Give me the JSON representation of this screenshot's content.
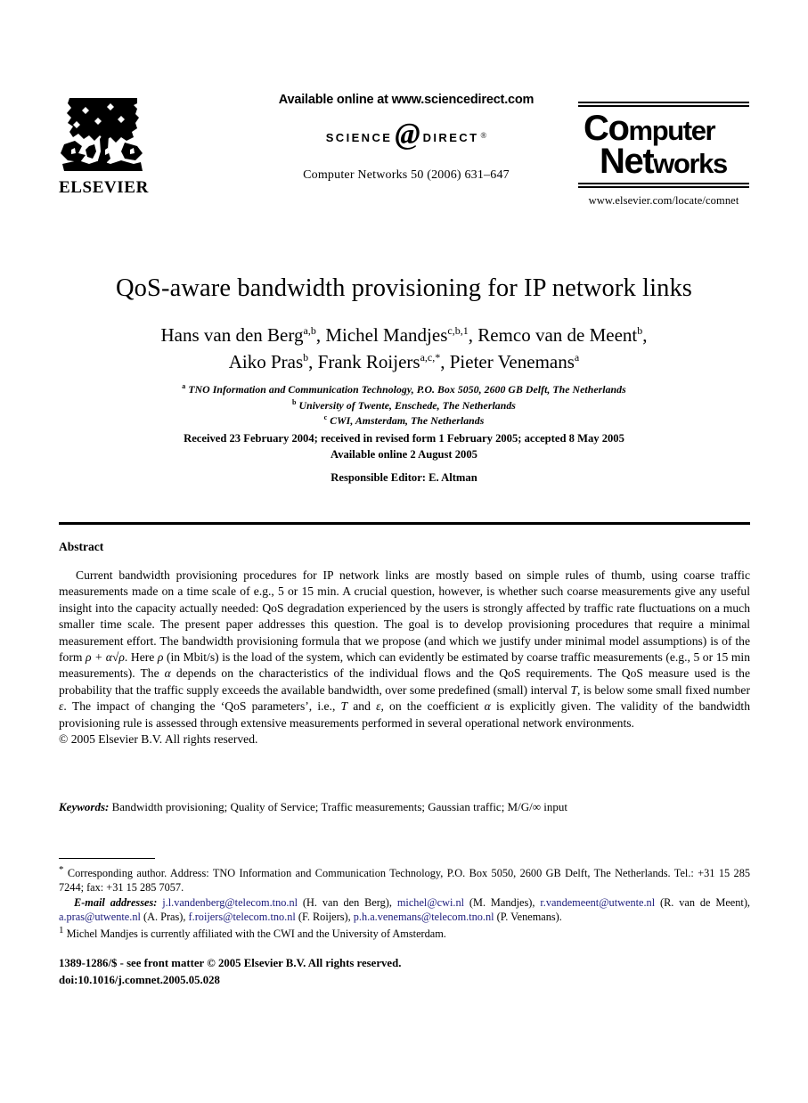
{
  "masthead": {
    "elsevier_wordmark": "ELSEVIER",
    "available_online": "Available online at www.sciencedirect.com",
    "sciencedirect_science": "SCIENCE",
    "sciencedirect_at": "@",
    "sciencedirect_direct": "DIRECT",
    "sciencedirect_reg": "®",
    "journal_citation": "Computer Networks 50 (2006) 631–647",
    "journal_logo_line1_a": "Co",
    "journal_logo_line1_b": "m",
    "journal_logo_line1_c": "puter",
    "journal_logo_line2_a": "Net",
    "journal_logo_line2_b": "works",
    "journal_url": "www.elsevier.com/locate/comnet"
  },
  "article": {
    "title": "QoS-aware bandwidth provisioning for IP network links",
    "authors_line1": "Hans van den Berg",
    "authors_line1_sup1": "a,b",
    "authors_line1_b": ", Michel Mandjes",
    "authors_line1_sup2": "c,b,1",
    "authors_line1_c": ", Remco van de Meent",
    "authors_line1_sup3": "b",
    "authors_line1_d": ",",
    "authors_line2": "Aiko Pras",
    "authors_line2_sup1": "b",
    "authors_line2_b": ", Frank Roijers",
    "authors_line2_sup2": "a,c,*",
    "authors_line2_c": ", Pieter Venemans",
    "authors_line2_sup3": "a",
    "affiliations": [
      {
        "mark": "a",
        "text": "TNO Information and Communication Technology, P.O. Box 5050, 2600 GB Delft, The Netherlands"
      },
      {
        "mark": "b",
        "text": "University of Twente, Enschede, The Netherlands"
      },
      {
        "mark": "c",
        "text": "CWI, Amsterdam, The Netherlands"
      }
    ],
    "dates_line1": "Received 23 February 2004; received in revised form 1 February 2005; accepted 8 May 2005",
    "dates_line2": "Available online 2 August 2005",
    "responsible_editor": "Responsible Editor: E. Altman"
  },
  "abstract": {
    "heading": "Abstract",
    "para_part1": "Current bandwidth provisioning procedures for IP network links are mostly based on simple rules of thumb, using coarse traffic measurements made on a time scale of e.g., 5 or 15 min. A crucial question, however, is whether such coarse measurements give any useful insight into the capacity actually needed: QoS degradation experienced by the users is strongly affected by traffic rate fluctuations on a much smaller time scale. The present paper addresses this question. The goal is to develop provisioning procedures that require a minimal measurement effort. The bandwidth provisioning formula that we propose (and which we justify under minimal model assumptions) is of the form ",
    "formula_1": "ρ + α√ρ",
    "para_part2": ". Here ",
    "rho": "ρ",
    "para_part3": " (in Mbit/s) is the load of the system, which can evidently be estimated by coarse traffic measurements (e.g., 5 or 15 min measurements). The ",
    "alpha": "α",
    "para_part4": " depends on the characteristics of the individual flows and the QoS requirements. The QoS measure used is the probability that the traffic supply exceeds the available bandwidth, over some predefined (small) interval ",
    "T1": "T",
    "para_part5": ", is below some small fixed number ",
    "eps1": "ε",
    "para_part6": ". The impact of changing the ‘QoS parameters’, i.e., ",
    "T2": "T",
    "para_part7": " and ",
    "eps2": "ε",
    "para_part8": ", on the coefficient ",
    "alpha2": "α",
    "para_part9": " is explicitly given. The validity of the bandwidth provisioning rule is assessed through extensive measurements performed in several operational network environments.",
    "copyright": "© 2005 Elsevier B.V. All rights reserved."
  },
  "keywords": {
    "label": "Keywords:",
    "text": " Bandwidth provisioning; Quality of Service; Traffic measurements; Gaussian traffic; M/G/∞ input"
  },
  "footnotes": {
    "corresponding_mark": "*",
    "corresponding_text": " Corresponding author. Address: TNO Information and Communication Technology, P.O. Box 5050, 2600 GB Delft, The Netherlands. Tel.: +31 15 285 7244; fax: +31 15 285 7057.",
    "email_label": "E-mail addresses:",
    "emails": [
      {
        "address": "j.l.vandenberg@telecom.tno.nl",
        "person": " (H. van den Berg), "
      },
      {
        "address": "michel@cwi.nl",
        "person": " (M. Mandjes), "
      },
      {
        "address": "r.vandemeent@utwente.nl",
        "person": " (R. van de Meent), "
      },
      {
        "address": "a.pras@utwente.nl",
        "person": " (A. Pras), "
      },
      {
        "address": "f.roijers@telecom.tno.nl",
        "person": " (F. Roijers), "
      },
      {
        "address": "p.h.a.venemans@telecom.tno.nl",
        "person": " (P. Venemans)."
      }
    ],
    "note1_mark": "1",
    "note1_text": " Michel Mandjes is currently affiliated with the CWI and the University of Amsterdam."
  },
  "imprint": {
    "line1": "1389-1286/$ - see front matter © 2005 Elsevier B.V. All rights reserved.",
    "line2": "doi:10.1016/j.comnet.2005.05.028"
  },
  "colors": {
    "text": "#000000",
    "email_link": "#1a1a7a",
    "background": "#ffffff"
  }
}
